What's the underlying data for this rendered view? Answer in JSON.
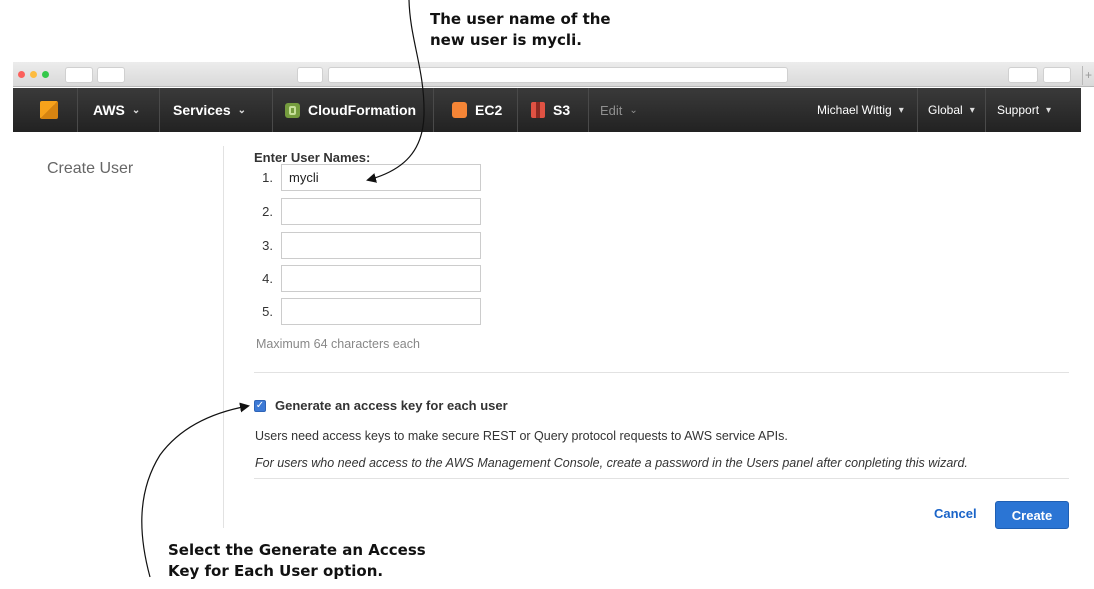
{
  "annotations": {
    "top_callout_line1": "The user name of the",
    "top_callout_line2": "new user is mycli.",
    "bottom_callout_line1": "Select the Generate an Access",
    "bottom_callout_line2": "Key for Each User option."
  },
  "browser": {
    "new_tab_symbol": "+"
  },
  "navbar": {
    "aws_label": "AWS",
    "services_label": "Services",
    "cloudformation_label": "CloudFormation",
    "ec2_label": "EC2",
    "s3_label": "S3",
    "edit_label": "Edit",
    "user_label": "Michael Wittig",
    "region_label": "Global",
    "support_label": "Support",
    "chevron": "⌄",
    "caret": "▾"
  },
  "sidebar": {
    "title": "Create User"
  },
  "form": {
    "label": "Enter User Names:",
    "users": [
      {
        "num": "1.",
        "value": "mycli"
      },
      {
        "num": "2.",
        "value": ""
      },
      {
        "num": "3.",
        "value": ""
      },
      {
        "num": "4.",
        "value": ""
      },
      {
        "num": "5.",
        "value": ""
      }
    ],
    "help": "Maximum 64 characters each",
    "access_key_checked": true,
    "checkbox_mark": "✓",
    "access_key_label": "Generate an access key for each user",
    "desc1": "Users need access keys to make secure REST or Query protocol requests to AWS service APIs.",
    "desc2": "For users who need access to the AWS Management Console, create a password in the Users panel after conpleting this wizard.",
    "cancel_label": "Cancel",
    "create_label": "Create"
  },
  "colors": {
    "navbar": "#232f3e",
    "primary_button": "#2b75d4",
    "link": "#1a64c8"
  }
}
